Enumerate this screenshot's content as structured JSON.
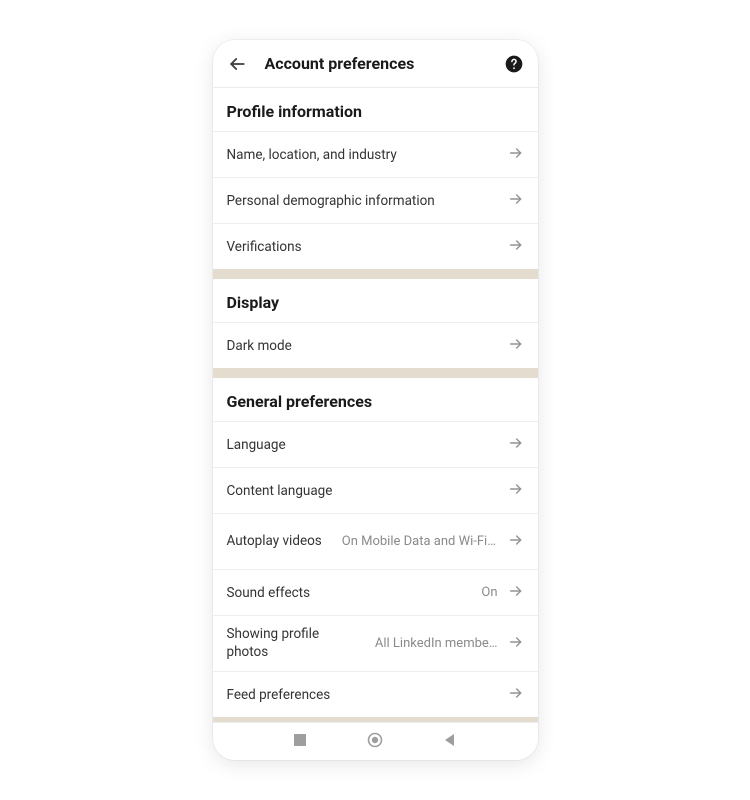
{
  "header": {
    "title": "Account preferences"
  },
  "sections": {
    "profile": {
      "header": "Profile information",
      "rows": {
        "name_location": "Name, location, and industry",
        "demographic": "Personal demographic information",
        "verifications": "Verifications"
      }
    },
    "display": {
      "header": "Display",
      "rows": {
        "dark_mode": "Dark mode"
      }
    },
    "general": {
      "header": "General preferences",
      "rows": {
        "language": "Language",
        "content_language": "Content language",
        "autoplay": {
          "label": "Autoplay videos",
          "value": "On Mobile Data and Wi-Fi Co…"
        },
        "sound": {
          "label": "Sound effects",
          "value": "On"
        },
        "profile_photos": {
          "label": "Showing profile photos",
          "value": "All LinkedIn membe…"
        },
        "feed": "Feed preferences"
      }
    }
  }
}
